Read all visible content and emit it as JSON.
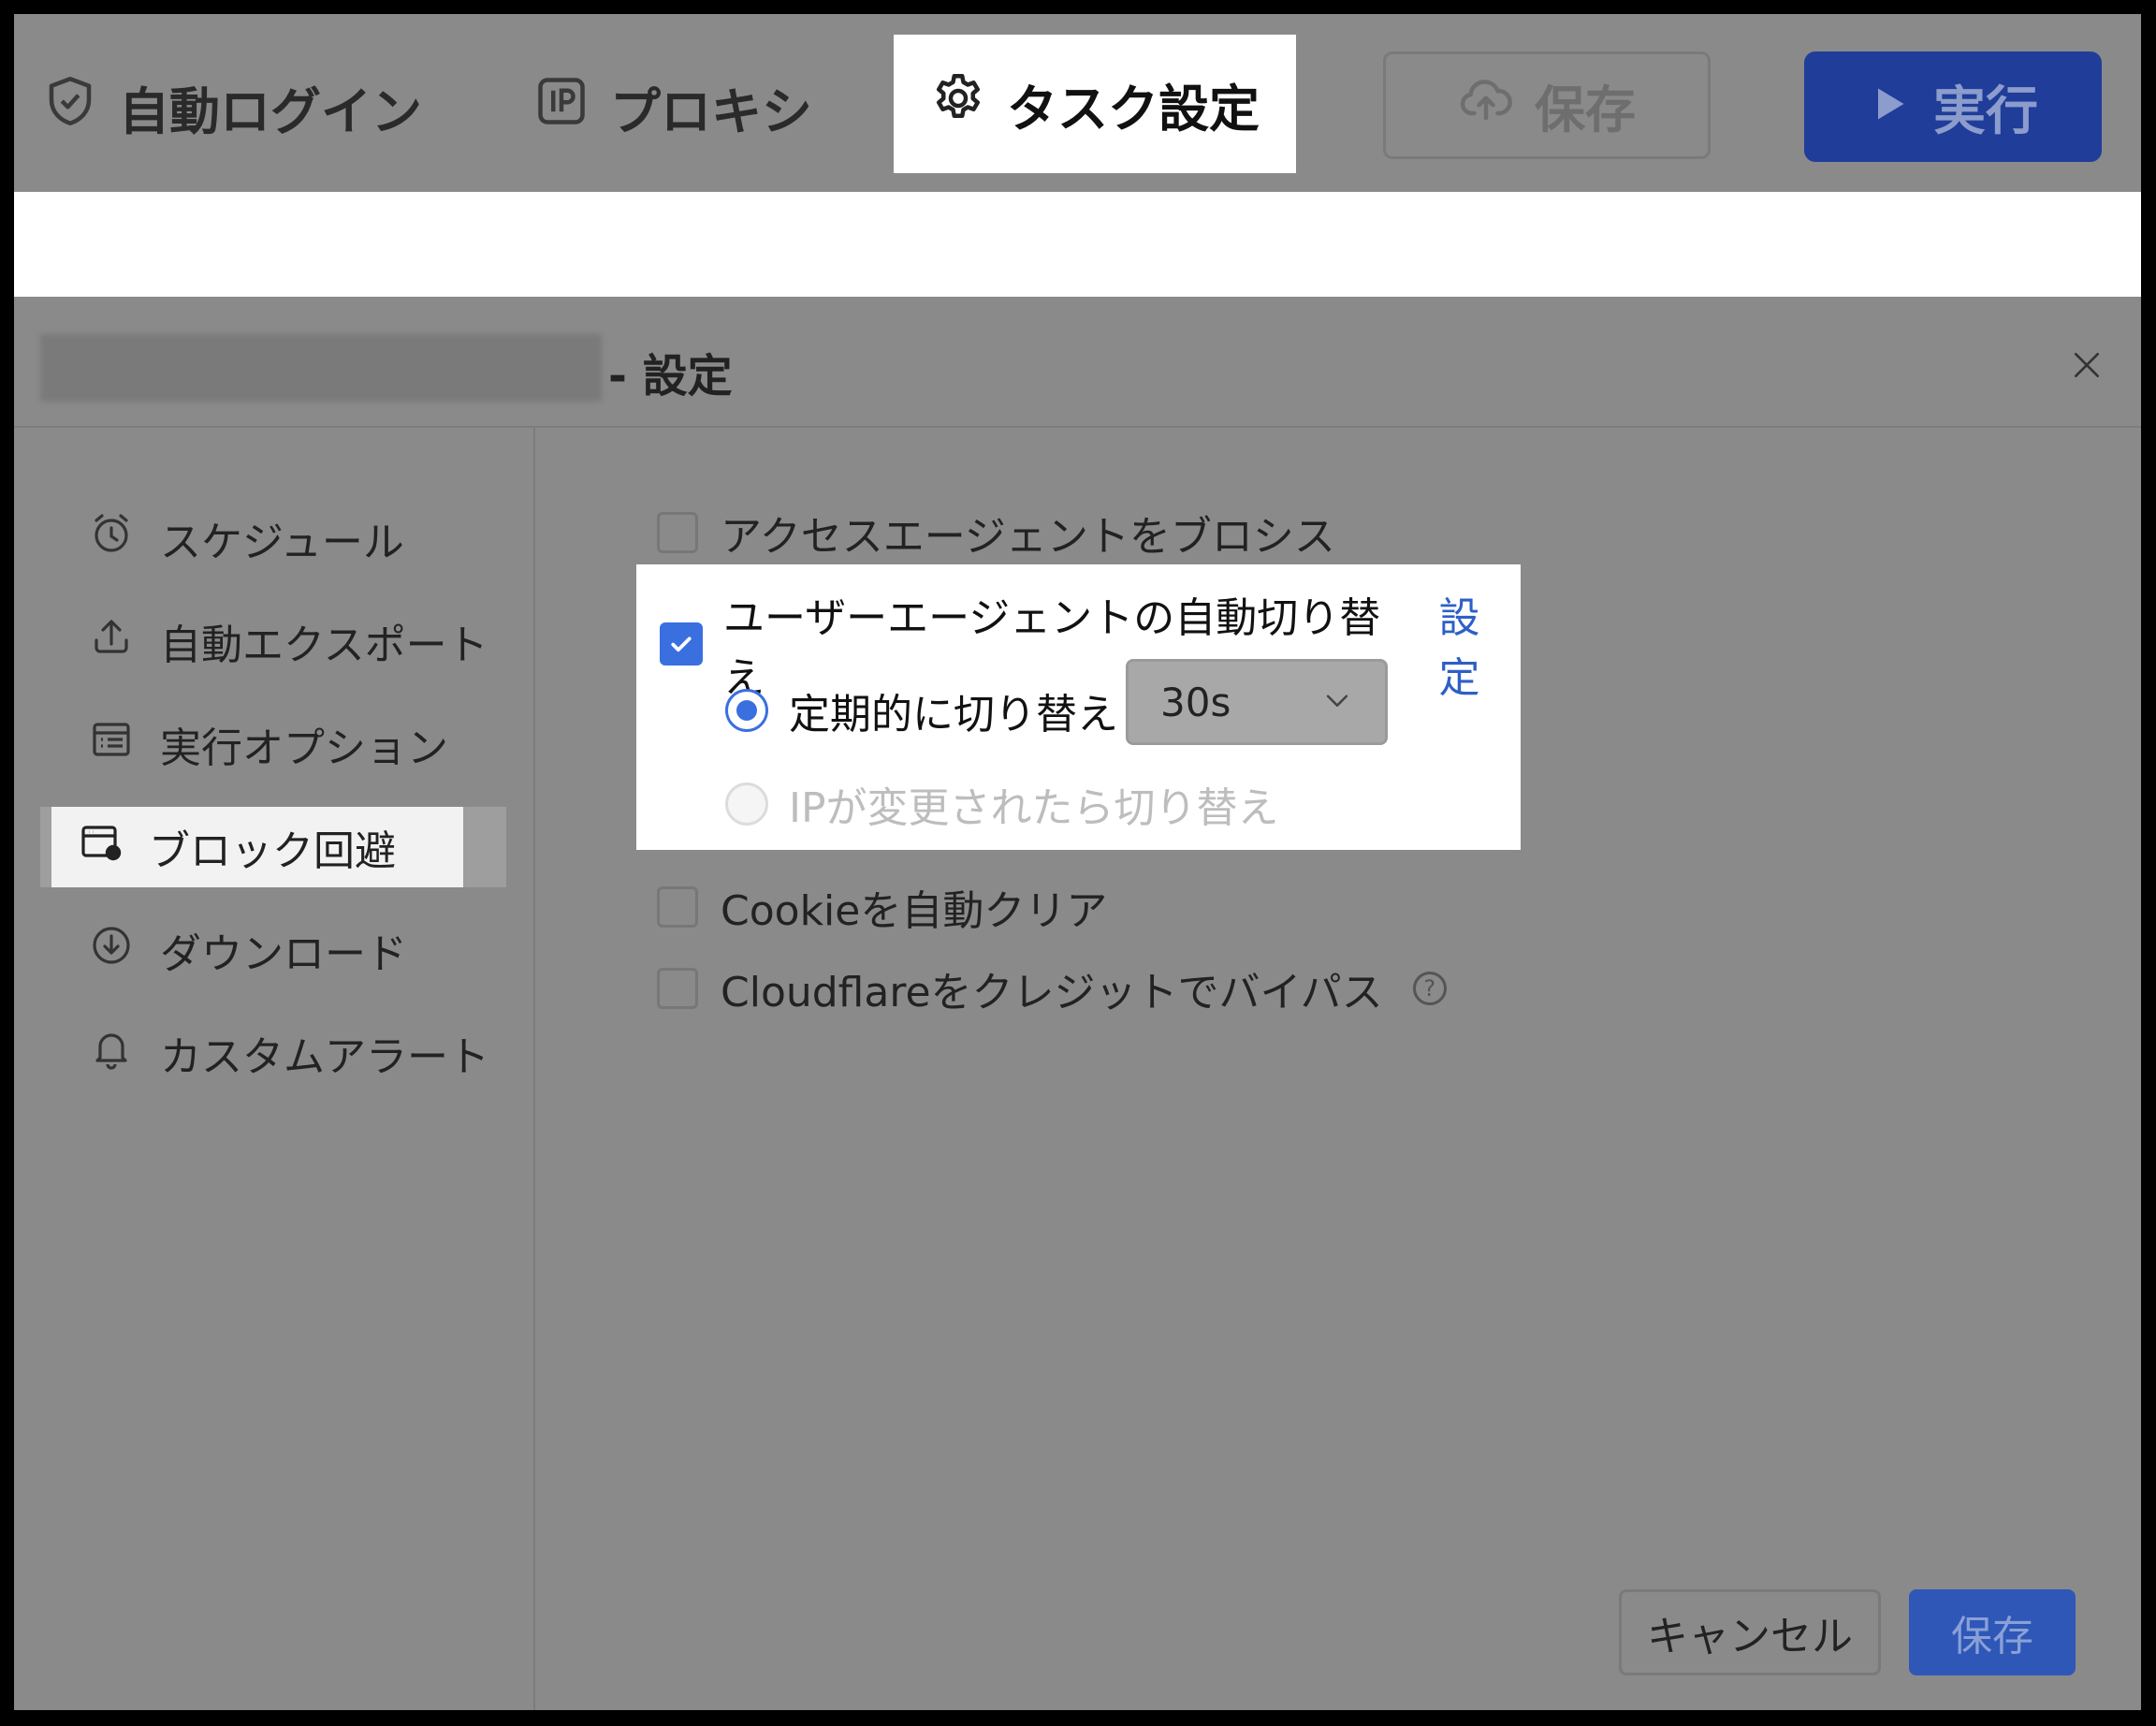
{
  "toolbar": {
    "tabs": [
      {
        "label": "自動ログイン",
        "icon": "shield-check-icon"
      },
      {
        "label": "プロキシ",
        "icon": "ip-icon"
      },
      {
        "label": "タスク設定",
        "icon": "gear-icon"
      }
    ],
    "save_label": "保存",
    "run_label": "実行"
  },
  "dialog": {
    "title_suffix": "- 設定",
    "sidebar": [
      {
        "label": "スケジュール",
        "icon": "alarm-clock-icon"
      },
      {
        "label": "自動エクスポート",
        "icon": "upload-icon"
      },
      {
        "label": "実行オプション",
        "icon": "list-icon"
      },
      {
        "label": "ブロック回避",
        "icon": "browser-shield-icon",
        "active": true
      },
      {
        "label": "ダウンロード",
        "icon": "download-icon"
      },
      {
        "label": "カスタムアラート",
        "icon": "bell-icon"
      }
    ],
    "options": {
      "access_agent": {
        "label": "アクセスエージェントをブロシス",
        "checked": false
      },
      "ua_switch": {
        "label": "ユーザーエージェントの自動切り替え",
        "link": "設定",
        "checked": true
      },
      "periodic": {
        "label": "定期的に切り替え",
        "selected": true
      },
      "interval": {
        "value": "30s"
      },
      "on_ip_change": {
        "label": "IPが変更されたら切り替え",
        "selected": false,
        "disabled": true
      },
      "cookie_clear": {
        "label": "Cookieを自動クリア",
        "checked": false
      },
      "cloudflare": {
        "label": "Cloudflareをクレジットでバイパス",
        "checked": false,
        "help": "?"
      }
    },
    "footer": {
      "cancel_label": "キャンセル",
      "save_label": "保存"
    }
  },
  "colors": {
    "accent": "#3a6fe0",
    "run_button": "#1f3d99",
    "overlay": "#8a8a8a"
  }
}
